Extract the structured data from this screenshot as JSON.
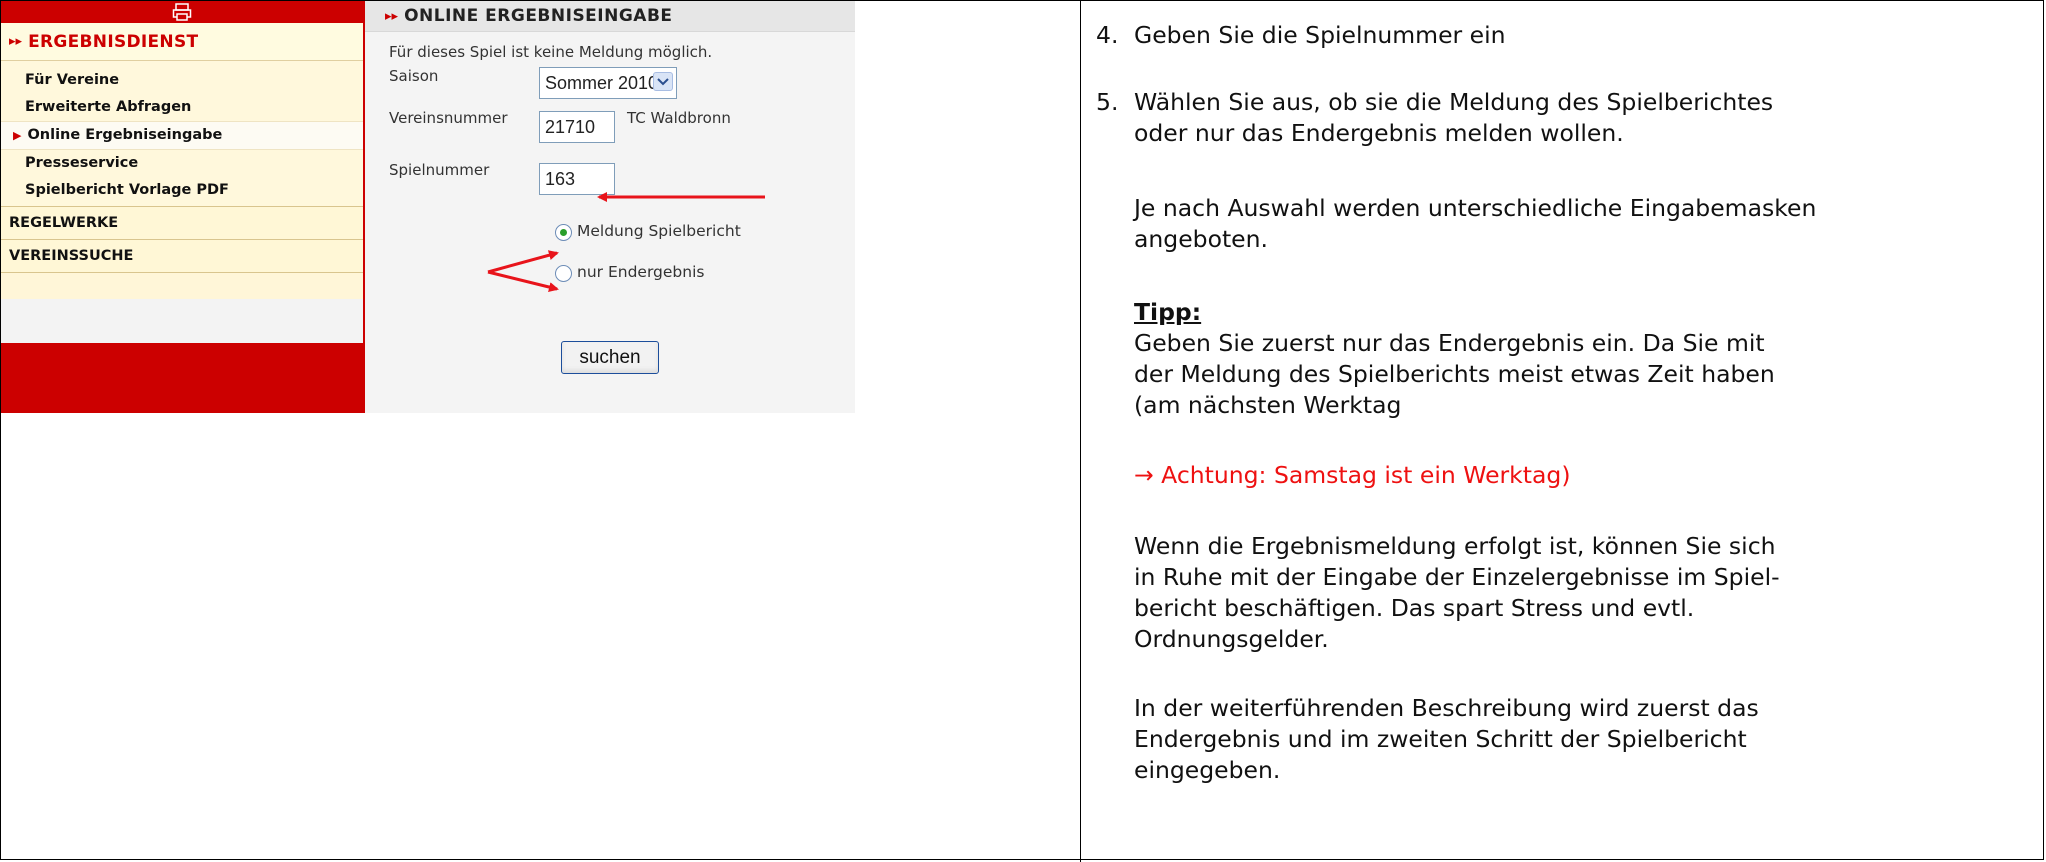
{
  "screenshot": {
    "sidebar": {
      "print_icon": "printer-icon",
      "section_title": "ERGEBNISDIENST",
      "items": [
        {
          "label": "Für Vereine"
        },
        {
          "label": "Erweiterte Abfragen"
        },
        {
          "label": "Online Ergebniseingabe"
        },
        {
          "label": "Presseservice"
        },
        {
          "label": "Spielbericht Vorlage PDF"
        }
      ],
      "categories": [
        "REGELWERKE",
        "VEREINSSUCHE"
      ]
    },
    "panel": {
      "title": "ONLINE ERGEBNISEINGABE",
      "message": "Für dieses Spiel ist keine Meldung möglich.",
      "saison_label": "Saison",
      "saison_value": "Sommer 2010",
      "verein_label": "Vereinsnummer",
      "verein_value": "21710",
      "verein_name": "TC Waldbronn",
      "spiel_label": "Spielnummer",
      "spiel_value": "163",
      "radio_1": "Meldung Spielbericht",
      "radio_1_checked": true,
      "radio_2": "nur Endergebnis",
      "radio_2_checked": false,
      "button": "suchen"
    },
    "colors": {
      "brand_red": "#cc0000",
      "annotation_red": "#e8141b"
    }
  },
  "instructions": {
    "step4_num": "4.",
    "step4": "Geben Sie die Spielnummer ein",
    "step5_num": "5.",
    "step5_line1": "Wählen Sie aus, ob sie die Meldung des Spielberichtes",
    "step5_line2": "oder nur das Endergebnis melden wollen.",
    "note_line1": "Je nach Auswahl werden unterschiedliche Eingabemasken",
    "note_line2": "angeboten.",
    "tip_heading": "Tipp:",
    "tip_line1": "Geben Sie zuerst nur das Endergebnis ein. Da Sie mit",
    "tip_line2": "der Meldung des Spielberichts meist etwas Zeit haben",
    "tip_line3": "(am nächsten Werktag",
    "warning": "→ Achtung: Samstag ist ein Werktag)",
    "after_line1": "Wenn die Ergebnismeldung erfolgt ist, können Sie sich",
    "after_line2": "in Ruhe mit der Eingabe der Einzelergebnisse im Spiel-",
    "after_line3": "bericht beschäftigen. Das spart Stress und evtl.",
    "after_line4": "Ordnungsgelder.",
    "final_line1": "In der weiterführenden Beschreibung wird zuerst das",
    "final_line2": "Endergebnis und im zweiten Schritt der Spielbericht",
    "final_line3": "eingegeben."
  }
}
